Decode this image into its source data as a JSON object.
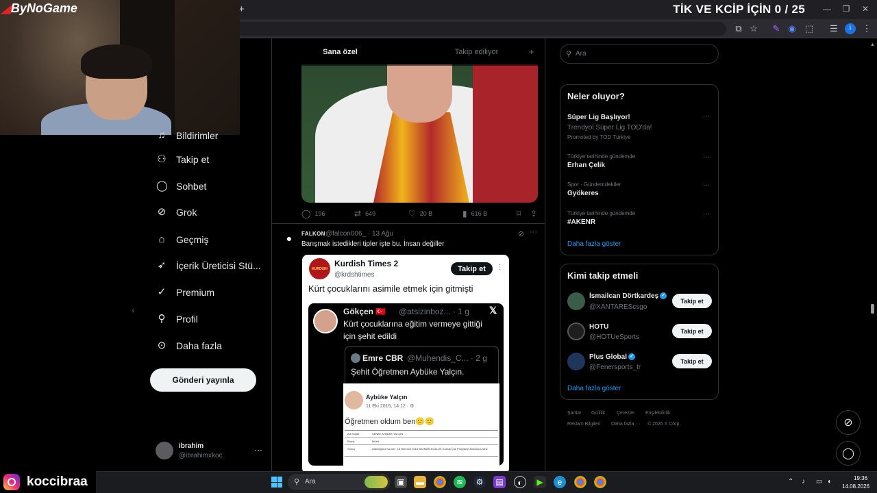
{
  "overlay": {
    "brand": "ByNoGame",
    "stream_title": "TİK VE KCİP İÇİN 0 / 25",
    "streamer_handle": "koccibraa"
  },
  "nav": {
    "items": [
      {
        "label": "Bildirimler",
        "icon": "bell-icon"
      },
      {
        "label": "Takip et",
        "icon": "person-plus-icon"
      },
      {
        "label": "Sohbet",
        "icon": "chat-bubble-icon"
      },
      {
        "label": "Grok",
        "icon": "grok-icon"
      },
      {
        "label": "Geçmiş",
        "icon": "bookmark-icon"
      },
      {
        "label": "İçerik Üreticisi Stü...",
        "icon": "rocket-icon"
      },
      {
        "label": "Premium",
        "icon": "verified-badge-icon"
      },
      {
        "label": "Profil",
        "icon": "person-icon"
      },
      {
        "label": "Daha fazla",
        "icon": "more-circle-icon"
      }
    ],
    "post_button": "Gönderi yayınla",
    "account": {
      "name": "ibrahim",
      "handle": "@ibrahimxkoc"
    }
  },
  "timeline": {
    "tabs": {
      "active": "Sana özel",
      "inactive": "Takip ediliyor"
    },
    "tweet1_actions": {
      "replies": "196",
      "retweets": "649",
      "likes": "20 B",
      "views": "616 B"
    },
    "tweet2": {
      "name": "FALKON",
      "handle_time": "@falcon006_ · 13 Ağu",
      "text": "Barışmak istedikleri tipler işte bu. İnsan değiller",
      "embed": {
        "logo_text": "KURDISH",
        "name": "Kurdish Times 2",
        "handle": "@krdshtimes",
        "follow": "Takip et",
        "text": "Kürt çocuklarını asimile etmek için gitmişti",
        "quote1": {
          "name": "Gökçen 🇹🇷",
          "handle": "@atsizinboz... · 1 g",
          "line1": "Kürt çocuklarına eğitim vermeye gittiği",
          "line2": "için şehit edildi"
        },
        "quote2": {
          "name": "Emre CBR",
          "handle": "@Muhendis_C... · 2 g",
          "text": "Şehit Öğretmen Aybüke Yalçın."
        },
        "fb": {
          "name": "Aybüke Yalçın",
          "date": "11 Eki 2016, 14:12 · ⚙",
          "text": "Öğretmen oldum ben🙂🙂",
          "rows": [
            [
              "Ad Soyad",
              "ŞENAY AYBÜKE YALÇIN"
            ],
            [
              "Branş",
              "Müzik"
            ],
            [
              "Sonuç",
              "Atandığınız Kurum : 18 Temmuz 2016 BATMAN KOZLUK Kozluk Çok Programlı Anadolu Lisesi"
            ]
          ]
        }
      }
    }
  },
  "sidebar": {
    "search_placeholder": "Ara",
    "trends_title": "Neler oluyor?",
    "trends": [
      {
        "meta": "Trendyol Süper Lig TOD'da!",
        "title": "Süper Lig Başlıyor!",
        "promo": "Promoted by TOD Türkiye"
      },
      {
        "meta": "Türkiye tarihinde gündemde",
        "title": "Erhan Çelik"
      },
      {
        "meta": "Spor · Gündemdekiler",
        "title": "Gyökeres"
      },
      {
        "meta": "Türkiye tarihinde gündemde",
        "title": "#AKENR"
      }
    ],
    "show_more": "Daha fazla göster",
    "who_title": "Kimi takip etmeli",
    "who": [
      {
        "name": "İsmailcan Dörtkardeş",
        "handle": "@XANTAREScsgo",
        "verified": true,
        "follow": "Takip et",
        "avatar_color": "#3b5b4b"
      },
      {
        "name": "HOTU",
        "handle": "@HOTUeSports",
        "verified": false,
        "follow": "Takip et",
        "avatar_color": "#1e1e1e"
      },
      {
        "name": "Plus Global",
        "handle": "@Fenersports_tr",
        "verified": true,
        "follow": "Takip et",
        "avatar_color": "#20355a"
      }
    ],
    "who_more": "Daha fazla göster",
    "footer": {
      "l1": "Şartlar",
      "l2": "Gizlilik",
      "l3": "Çerezler",
      "l4": "Erişilebilirlik",
      "l5": "Reklam Bilgileri",
      "l6": "Daha fazla ···",
      "l7": "© 2026 X Corp."
    }
  },
  "taskbar": {
    "search": "Ara",
    "time": "19:36",
    "date": "14.08.2026"
  },
  "colors": {
    "accent": "#1d9bf0",
    "background": "#000000"
  }
}
